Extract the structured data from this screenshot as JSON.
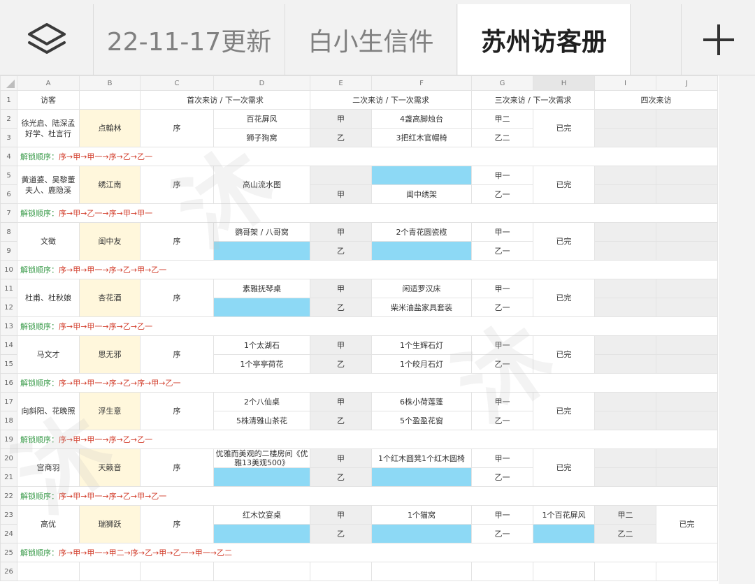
{
  "tabs": [
    {
      "label": "22-11-17更新",
      "active": false
    },
    {
      "label": "白小生信件",
      "active": false
    },
    {
      "label": "苏州访客册",
      "active": true
    }
  ],
  "columns": [
    "A",
    "B",
    "C",
    "D",
    "E",
    "F",
    "G",
    "H",
    "I",
    "J"
  ],
  "header_row": {
    "num": "1",
    "visitor": "访客",
    "first": "首次来访 / 下一次需求",
    "second": "二次来访 / 下一次需求",
    "third": "三次来访 / 下一次需求",
    "fourth": "四次来访"
  },
  "common": {
    "xu": "序",
    "jia": "甲",
    "yi": "乙",
    "jia1": "甲一",
    "yi1": "乙一",
    "jia2": "甲二",
    "yi2": "乙二",
    "done": "已完",
    "unlock_label": "解锁顺序："
  },
  "groups": [
    {
      "rows": [
        "2",
        "3"
      ],
      "visitor": "徐光启、陆深孟好学、杜言行",
      "station": "点翰林",
      "d1": "百花屏风",
      "d2": "狮子狗窝",
      "e1": "甲",
      "e2": "乙",
      "f1": "4盏高脚烛台",
      "f2": "3把红木官帽椅",
      "g1": "甲二",
      "g2": "乙二",
      "unlock_row": "4",
      "unlock": "序→甲→甲一→序→乙→乙一"
    },
    {
      "rows": [
        "5",
        "6"
      ],
      "visitor": "黄道婆、吴黎董夫人、鹿隐溪",
      "station": "绣江南",
      "d_merged": "高山流水图",
      "e1": "",
      "e2": "甲",
      "f1": "",
      "f2": "闺中绣架",
      "g1": "甲一",
      "g2": "乙一",
      "unlock_row": "7",
      "unlock": "序→甲→乙一→序→甲→甲一"
    },
    {
      "rows": [
        "8",
        "9"
      ],
      "visitor": "文徵",
      "station": "闺中友",
      "d1": "鹦哥架 / 八哥窝",
      "d2": "",
      "e1": "甲",
      "e2": "乙",
      "f1": "2个青花圆瓷榄",
      "f2": "",
      "g1": "甲一",
      "g2": "乙一",
      "unlock_row": "10",
      "unlock": "序→甲→甲一→序→乙→甲→乙一"
    },
    {
      "rows": [
        "11",
        "12"
      ],
      "visitor": "杜甫、杜秋娘",
      "station": "杏花酒",
      "d1": "素雅抚琴桌",
      "d2": "",
      "e1": "甲",
      "e2": "乙",
      "f1": "闲适罗汉床",
      "f2": "柴米油盐家具套装",
      "g1": "甲一",
      "g2": "乙一",
      "unlock_row": "13",
      "unlock": "序→甲→甲一→序→乙→乙一"
    },
    {
      "rows": [
        "14",
        "15"
      ],
      "visitor": "马文才",
      "station": "思无邪",
      "d1": "1个太湖石",
      "d2": "1个亭亭荷花",
      "e1": "甲",
      "e2": "乙",
      "f1": "1个生辉石灯",
      "f2": "1个皎月石灯",
      "g1": "甲一",
      "g2": "乙一",
      "unlock_row": "16",
      "unlock": "序→甲→甲一→序→乙→序→甲→乙一"
    },
    {
      "rows": [
        "17",
        "18"
      ],
      "visitor": "向斜阳、花晚照",
      "station": "浮生意",
      "d1": "2个八仙桌",
      "d2": "5株清雅山茶花",
      "e1": "甲",
      "e2": "乙",
      "f1": "6株小荷莲蓬",
      "f2": "5个盈盈花窗",
      "g1": "甲一",
      "g2": "乙一",
      "unlock_row": "19",
      "unlock": "序→甲→甲一→序→乙→乙一"
    },
    {
      "rows": [
        "20",
        "21"
      ],
      "visitor": "宫商羽",
      "station": "天籁音",
      "d1": "优雅而美观的二楼房间《优雅13美观500》",
      "d2": "",
      "e1": "甲",
      "e2": "乙",
      "f1": "1个红木圆凳1个红木圆椅",
      "f2": "",
      "g1": "甲一",
      "g2": "乙一",
      "unlock_row": "22",
      "unlock": "序→甲→甲一→序→乙→甲→乙一"
    },
    {
      "rows": [
        "23",
        "24"
      ],
      "visitor": "高优",
      "station": "瑞狮跃",
      "d1": "红木饮宴桌",
      "d2": "",
      "e1": "甲",
      "e2": "乙",
      "f1": "1个猫窝",
      "f2": "",
      "g1": "甲一",
      "g2": "乙一",
      "h1": "1个百花屏风",
      "i1": "甲二",
      "i2": "乙二",
      "unlock_row": "25",
      "unlock": "序→甲→甲一→甲二→序→乙→甲→乙一→甲一→乙二"
    }
  ],
  "last_row": "26"
}
